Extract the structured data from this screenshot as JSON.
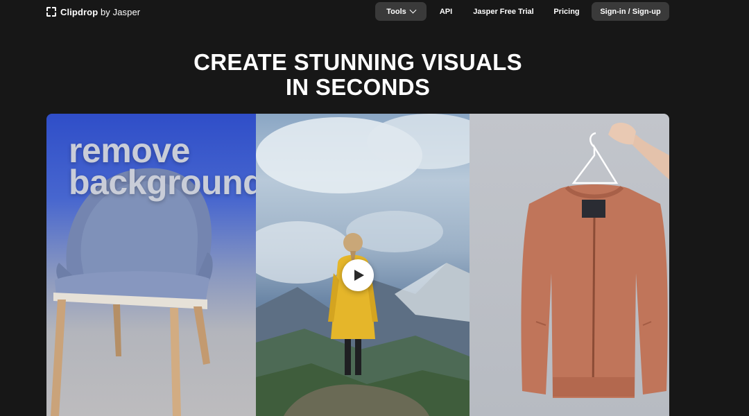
{
  "nav": {
    "logo_brand": "Clipdrop",
    "logo_suffix": " by Jasper",
    "tools_label": "Tools",
    "api_label": "API",
    "trial_label": "Jasper Free Trial",
    "pricing_label": "Pricing",
    "signin_label": "Sign-in / Sign-up"
  },
  "hero": {
    "line1": "CREATE STUNNING VISUALS",
    "line2": "IN SECONDS"
  },
  "media": {
    "overlay_line1": "remove",
    "overlay_line2": "background",
    "play_icon": "play-icon"
  },
  "colors": {
    "background": "#171717",
    "button_bg": "#3a3a3a",
    "text": "#ffffff"
  }
}
